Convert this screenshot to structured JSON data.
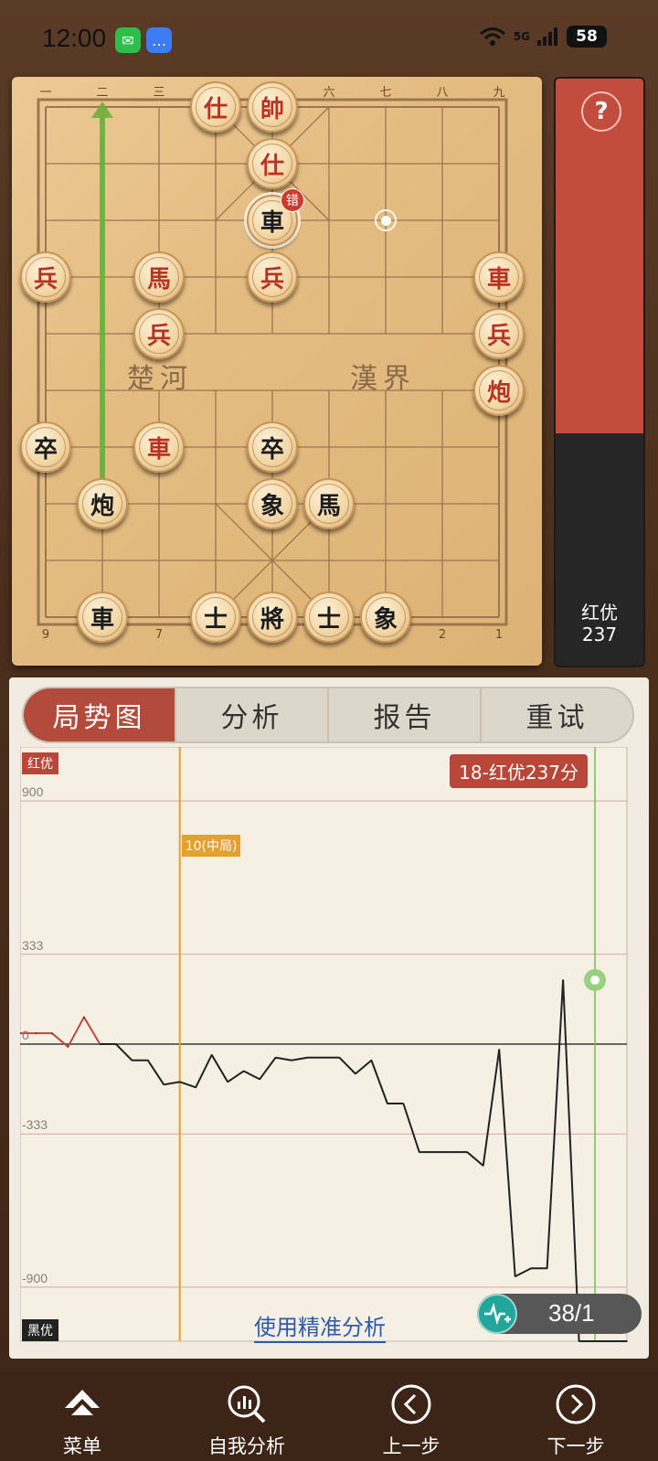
{
  "status_bar": {
    "time": "12:00",
    "network": "5G",
    "battery": "58"
  },
  "board": {
    "top_labels": [
      "一",
      "二",
      "三",
      "四",
      "五",
      "六",
      "七",
      "八",
      "九"
    ],
    "bottom_labels": [
      "9",
      "8",
      "7",
      "6",
      "5",
      "4",
      "3",
      "2",
      "1"
    ],
    "river_left": "楚河",
    "river_right": "漢界",
    "error_badge": "错",
    "pieces": [
      {
        "char": "仕",
        "side": "red",
        "col": 3,
        "row": 0
      },
      {
        "char": "帥",
        "side": "red",
        "col": 4,
        "row": 0
      },
      {
        "char": "仕",
        "side": "red",
        "col": 4,
        "row": 1
      },
      {
        "char": "車",
        "side": "black",
        "col": 4,
        "row": 2,
        "selected": true
      },
      {
        "char": "兵",
        "side": "red",
        "col": 0,
        "row": 3
      },
      {
        "char": "馬",
        "side": "red",
        "col": 2,
        "row": 3
      },
      {
        "char": "兵",
        "side": "red",
        "col": 4,
        "row": 3
      },
      {
        "char": "車",
        "side": "red",
        "col": 8,
        "row": 3
      },
      {
        "char": "兵",
        "side": "red",
        "col": 2,
        "row": 4
      },
      {
        "char": "兵",
        "side": "red",
        "col": 8,
        "row": 4
      },
      {
        "char": "炮",
        "side": "red",
        "col": 8,
        "row": 5
      },
      {
        "char": "卒",
        "side": "black",
        "col": 0,
        "row": 6
      },
      {
        "char": "車",
        "side": "red",
        "col": 2,
        "row": 6
      },
      {
        "char": "卒",
        "side": "black",
        "col": 4,
        "row": 6
      },
      {
        "char": "炮",
        "side": "black",
        "col": 1,
        "row": 7
      },
      {
        "char": "象",
        "side": "black",
        "col": 4,
        "row": 7
      },
      {
        "char": "馬",
        "side": "black",
        "col": 5,
        "row": 7
      },
      {
        "char": "車",
        "side": "black",
        "col": 1,
        "row": 9
      },
      {
        "char": "士",
        "side": "black",
        "col": 3,
        "row": 9
      },
      {
        "char": "將",
        "side": "black",
        "col": 4,
        "row": 9
      },
      {
        "char": "士",
        "side": "black",
        "col": 5,
        "row": 9
      },
      {
        "char": "象",
        "side": "black",
        "col": 6,
        "row": 9
      }
    ]
  },
  "eval_bar": {
    "help_symbol": "?",
    "label": "红优",
    "score": "237",
    "red_fraction": 0.6
  },
  "tabs": [
    {
      "label": "局势图",
      "active": true
    },
    {
      "label": "分析",
      "active": false
    },
    {
      "label": "报告",
      "active": false
    },
    {
      "label": "重试",
      "active": false
    }
  ],
  "chart_data": {
    "type": "line",
    "top_label": "红优",
    "bottom_label": "黑优",
    "score_badge": "18-红优237分",
    "phase_marker": {
      "x": 10,
      "label": "10(中局)"
    },
    "yticks": [
      900,
      333,
      0,
      -333,
      -900
    ],
    "ylim": [
      -1100,
      1100
    ],
    "x": [
      0,
      1,
      2,
      3,
      4,
      5,
      6,
      7,
      8,
      9,
      10,
      11,
      12,
      13,
      14,
      15,
      16,
      17,
      18,
      19,
      20,
      21,
      22,
      23,
      24,
      25,
      26,
      27,
      28,
      29,
      30,
      31,
      32,
      33,
      34,
      35,
      36,
      37,
      38
    ],
    "values": [
      40,
      40,
      40,
      -10,
      100,
      0,
      0,
      -60,
      -60,
      -150,
      -140,
      -160,
      -40,
      -140,
      -100,
      -130,
      -50,
      -60,
      -50,
      -50,
      -50,
      -110,
      -60,
      -220,
      -220,
      -400,
      -400,
      -400,
      -400,
      -450,
      -20,
      -860,
      -830,
      -830,
      237,
      -1100,
      -1100,
      -1100,
      -1100
    ],
    "current_x": 36
  },
  "precise_link": "使用精准分析",
  "counter": "38/1",
  "nav": [
    {
      "label": "菜单",
      "icon": "menu-icon"
    },
    {
      "label": "自我分析",
      "icon": "self-analysis-icon"
    },
    {
      "label": "上一步",
      "icon": "prev-step-icon"
    },
    {
      "label": "下一步",
      "icon": "next-step-icon"
    }
  ]
}
